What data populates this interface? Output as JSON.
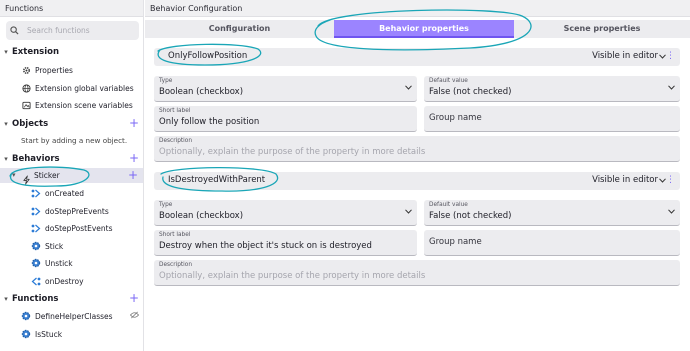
{
  "sidebar": {
    "title": "Functions",
    "search_placeholder": "Search functions",
    "extension": {
      "label": "Extension",
      "items": [
        {
          "label": "Properties",
          "icon": "gear-icon"
        },
        {
          "label": "Extension global variables",
          "icon": "globe-icon"
        },
        {
          "label": "Extension scene variables",
          "icon": "scene-icon"
        }
      ]
    },
    "objects": {
      "label": "Objects",
      "hint": "Start by adding a new object."
    },
    "behaviors": {
      "label": "Behaviors",
      "selected": "Sticker",
      "items": [
        {
          "label": "onCreated",
          "icon": "lifecycle-icon"
        },
        {
          "label": "doStepPreEvents",
          "icon": "lifecycle-icon"
        },
        {
          "label": "doStepPostEvents",
          "icon": "lifecycle-icon"
        },
        {
          "label": "Stick",
          "icon": "action-gear-icon"
        },
        {
          "label": "Unstick",
          "icon": "action-gear-icon"
        },
        {
          "label": "onDestroy",
          "icon": "lifecycle-icon"
        }
      ]
    },
    "functions": {
      "label": "Functions",
      "items": [
        {
          "label": "DefineHelperClasses",
          "icon": "action-gear-icon"
        },
        {
          "label": "IsStuck",
          "icon": "action-gear-icon"
        }
      ]
    }
  },
  "main": {
    "title": "Behavior Configuration",
    "tabs": [
      {
        "label": "Configuration"
      },
      {
        "label": "Behavior properties",
        "active": true
      },
      {
        "label": "Scene properties"
      }
    ],
    "properties": [
      {
        "name": "OnlyFollowPosition",
        "visibility": "Visible in editor",
        "type_label": "Type",
        "type_value": "Boolean (checkbox)",
        "default_label": "Default value",
        "default_value": "False (not checked)",
        "short_label_label": "Short label",
        "short_label_value": "Only follow the position",
        "group_placeholder": "Group name",
        "description_label": "Description",
        "description_placeholder": "Optionally, explain the purpose of the property in more details"
      },
      {
        "name": "IsDestroyedWithParent",
        "visibility": "Visible in editor",
        "type_label": "Type",
        "type_value": "Boolean (checkbox)",
        "default_label": "Default value",
        "default_value": "False (not checked)",
        "short_label_label": "Short label",
        "short_label_value": "Destroy when the object it's stuck on is destroyed",
        "group_placeholder": "Group name",
        "description_label": "Description",
        "description_placeholder": "Optionally, explain the purpose of the property in more details"
      }
    ]
  },
  "colors": {
    "accent": "#7a67f5",
    "active_tab": "#9b84ff",
    "annotation": "#1aa6b7",
    "panel": "#ececef"
  }
}
